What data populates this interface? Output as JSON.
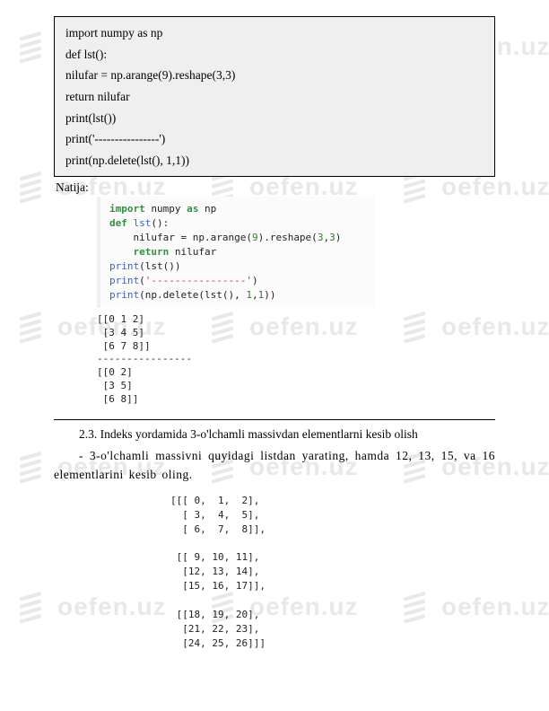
{
  "watermark_text": "oefen.uz",
  "codebox": {
    "l1": "import numpy as np",
    "l2": "def lst():",
    "l3": "    nilufar = np.arange(9).reshape(3,3)",
    "l4": "    return nilufar",
    "l5": "print(lst())",
    "l6": "print('----------------')",
    "l7": "print(np.delete(lst(), 1,1))"
  },
  "natija": "Natija:",
  "py": {
    "line1_a": "import",
    "line1_b": " numpy ",
    "line1_c": "as",
    "line1_d": " np",
    "line2_a": "def",
    "line2_b": " ",
    "line2_c": "lst",
    "line2_d": "():",
    "line3_a": "    nilufar = np.arange(",
    "line3_b": "9",
    "line3_c": ").reshape(",
    "line3_d": "3",
    "line3_e": ",",
    "line3_f": "3",
    "line3_g": ")",
    "line4_a": "    ",
    "line4_b": "return",
    "line4_c": " nilufar",
    "line5_a": "print",
    "line5_b": "(lst())",
    "line6_a": "print",
    "line6_b": "(",
    "line6_c": "'----------------'",
    "line6_d": ")",
    "line7_a": "print",
    "line7_b": "(np.delete(lst(), ",
    "line7_c": "1",
    "line7_d": ",",
    "line7_e": "1",
    "line7_f": "))"
  },
  "out1": "[[0 1 2]\n [3 4 5]\n [6 7 8]]\n----------------\n[[0 2]\n [3 5]\n [6 8]]",
  "section_title": "2.3. Indeks yordamida 3-o'lchamli massivdan elementlarni kesib olish",
  "paragraph": "- 3-o'lchamli  massivni  quyidagi  listdan  yarating,  hamda  12,  13,  15,  va  16 elementlarini kesib oling.",
  "arr": "[[[ 0,  1,  2],\n  [ 3,  4,  5],\n  [ 6,  7,  8]],\n\n [[ 9, 10, 11],\n  [12, 13, 14],\n  [15, 16, 17]],\n\n [[18, 19, 20],\n  [21, 22, 23],\n  [24, 25, 26]]]",
  "chart_data": {
    "type": "table",
    "title": "3D array (3×3×3) from arange(27)",
    "data": [
      [
        [
          0,
          1,
          2
        ],
        [
          3,
          4,
          5
        ],
        [
          6,
          7,
          8
        ]
      ],
      [
        [
          9,
          10,
          11
        ],
        [
          12,
          13,
          14
        ],
        [
          15,
          16,
          17
        ]
      ],
      [
        [
          18,
          19,
          20
        ],
        [
          21,
          22,
          23
        ],
        [
          24,
          25,
          26
        ]
      ]
    ]
  }
}
